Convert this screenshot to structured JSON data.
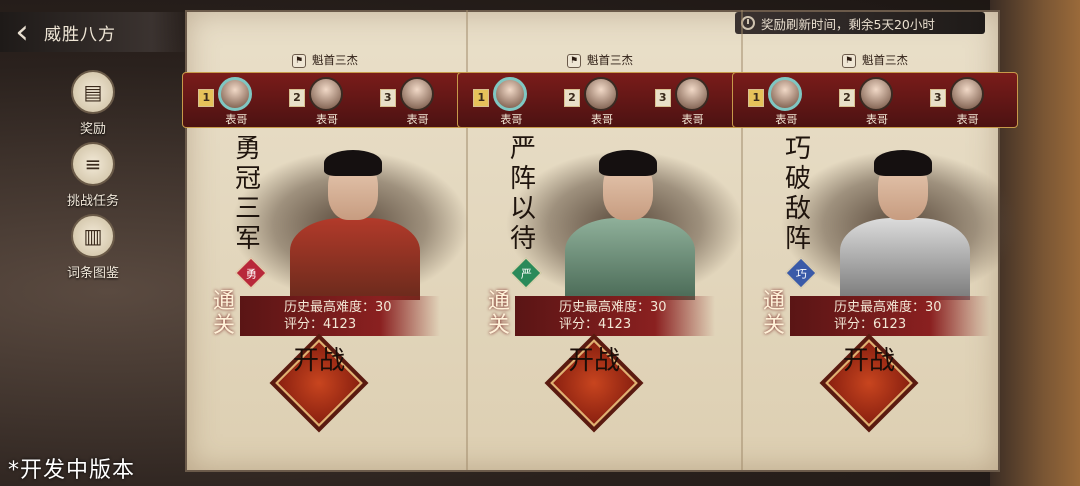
{
  "header": {
    "title": "威胜八方",
    "back_icon": "chevron-left-icon"
  },
  "timer": {
    "text": "奖励刷新时间，剩余5天20小时"
  },
  "sidebar": [
    {
      "label": "奖励",
      "icon": "chest-icon"
    },
    {
      "label": "挑战任务",
      "icon": "scroll-icon"
    },
    {
      "label": "词条图鉴",
      "icon": "cards-icon"
    }
  ],
  "cards": [
    {
      "rank_title": "魁首三杰",
      "slots": [
        {
          "rank": "1",
          "name": "表哥"
        },
        {
          "rank": "2",
          "name": "表哥"
        },
        {
          "rank": "3",
          "name": "表哥"
        }
      ],
      "motto": "勇冠三军",
      "badge": "勇",
      "badge_color": "#b8283a",
      "clear_tag": "通关",
      "best_label": "历史最高难度：30",
      "score_label": "评分：4123",
      "fight_label": "开战"
    },
    {
      "rank_title": "魁首三杰",
      "slots": [
        {
          "rank": "1",
          "name": "表哥"
        },
        {
          "rank": "2",
          "name": "表哥"
        },
        {
          "rank": "3",
          "name": "表哥"
        }
      ],
      "motto": "严阵以待",
      "badge": "严",
      "badge_color": "#2a8a5a",
      "clear_tag": "通关",
      "best_label": "历史最高难度：30",
      "score_label": "评分：4123",
      "fight_label": "开战"
    },
    {
      "rank_title": "魁首三杰",
      "slots": [
        {
          "rank": "1",
          "name": "表哥"
        },
        {
          "rank": "2",
          "name": "表哥"
        },
        {
          "rank": "3",
          "name": "表哥"
        }
      ],
      "motto": "巧破敌阵",
      "badge": "巧",
      "badge_color": "#3a5aa8",
      "clear_tag": "通关",
      "best_label": "历史最高难度：30",
      "score_label": "评分：6123",
      "fight_label": "开战"
    }
  ],
  "watermark": "*开发中版本"
}
